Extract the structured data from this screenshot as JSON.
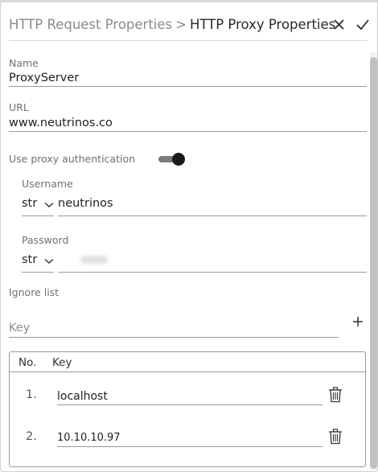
{
  "header": {
    "breadcrumb_parent": "HTTP Request Properties",
    "breadcrumb_separator": ">",
    "breadcrumb_current": "HTTP Proxy Properties",
    "close_icon": "close-icon",
    "confirm_icon": "check-icon"
  },
  "form": {
    "name": {
      "label": "Name",
      "value": "ProxyServer"
    },
    "url": {
      "label": "URL",
      "value": "www.neutrinos.co"
    },
    "proxy_auth": {
      "label": "Use proxy authentication",
      "enabled": true
    },
    "username": {
      "label": "Username",
      "type": "str",
      "value": "neutrinos"
    },
    "password": {
      "label": "Password",
      "type": "str",
      "value_masked": true
    },
    "ignore_list": {
      "label": "Ignore list",
      "key_placeholder": "Key",
      "add_icon": "plus-icon"
    }
  },
  "table": {
    "columns": [
      "No.",
      "Key"
    ],
    "rows": [
      {
        "no": "1.",
        "key": "localhost"
      },
      {
        "no": "2.",
        "key": "10.10.10.97"
      }
    ],
    "delete_icon": "trash-icon"
  },
  "colors": {
    "border": "#cfcfcf",
    "text_muted": "#8a8a8a",
    "toggle_thumb": "#1a1a1a",
    "toggle_track": "#7b7b7b"
  }
}
